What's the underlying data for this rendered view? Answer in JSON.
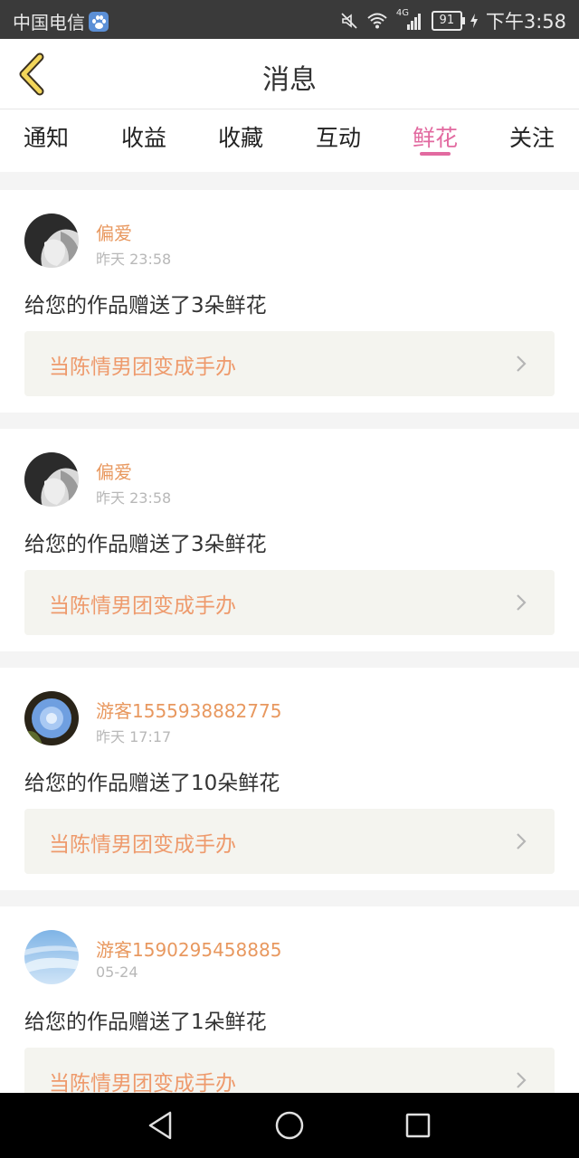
{
  "status_bar": {
    "carrier": "中国电信",
    "network_badge": "4G",
    "battery": "91",
    "time": "下午3:58",
    "icons": [
      "baidu-paw-icon",
      "mute-icon",
      "wifi-icon",
      "signal-icon",
      "battery-icon",
      "charging-icon"
    ]
  },
  "header": {
    "title": "消息",
    "back_icon": "chevron-left-icon"
  },
  "tabs": [
    {
      "label": "通知"
    },
    {
      "label": "收益"
    },
    {
      "label": "收藏"
    },
    {
      "label": "互动"
    },
    {
      "label": "鲜花",
      "active": true
    },
    {
      "label": "关注"
    }
  ],
  "messages": [
    {
      "user": "偏爱",
      "time": "昨天 23:58",
      "text": "给您的作品赠送了3朵鲜花",
      "work_title": "当陈情男团变成手办"
    },
    {
      "user": "偏爱",
      "time": "昨天 23:58",
      "text": "给您的作品赠送了3朵鲜花",
      "work_title": "当陈情男团变成手办"
    },
    {
      "user": "游客1555938882775",
      "time": "昨天 17:17",
      "text": "给您的作品赠送了10朵鲜花",
      "work_title": "当陈情男团变成手办"
    },
    {
      "user": "游客1590295458885",
      "time": "05-24",
      "text": "给您的作品赠送了1朵鲜花",
      "work_title": "当陈情男团变成手办"
    }
  ],
  "system_nav": [
    "back-triangle-icon",
    "home-circle-icon",
    "recents-square-icon"
  ],
  "colors": {
    "accent": "#e26aa0",
    "username": "#e8985f",
    "work_title": "#ee9a6c",
    "work_bg": "#f4f4ef",
    "status_bar_bg": "#3a3a3a"
  }
}
